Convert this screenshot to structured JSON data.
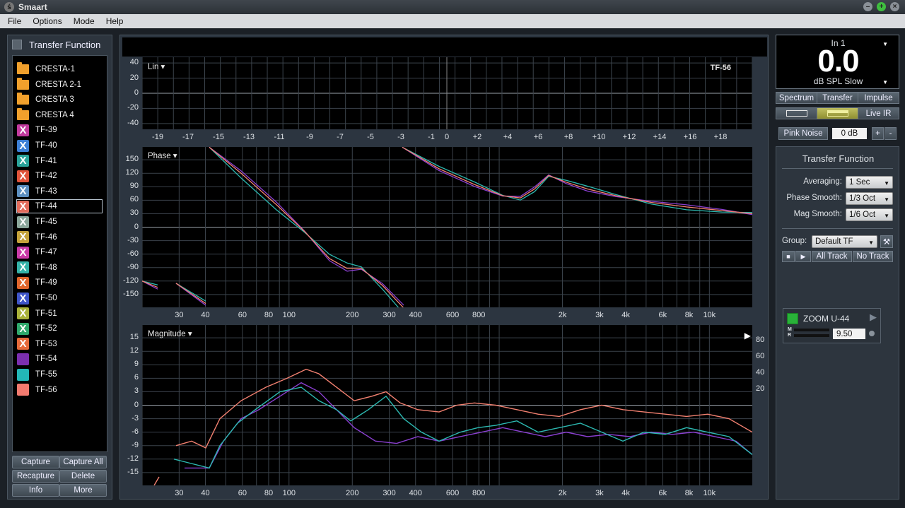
{
  "window": {
    "title": "Smaart"
  },
  "menu": [
    "File",
    "Options",
    "Mode",
    "Help"
  ],
  "sidebar": {
    "header": "Transfer Function",
    "items": [
      {
        "label": "CRESTA-1",
        "kind": "folder"
      },
      {
        "label": "CRESTA 2-1",
        "kind": "folder"
      },
      {
        "label": "CRESTA 3",
        "kind": "folder"
      },
      {
        "label": "CRESTA 4",
        "kind": "folder"
      },
      {
        "label": "TF-39",
        "kind": "x",
        "color": "#c23a9e"
      },
      {
        "label": "TF-40",
        "kind": "x",
        "color": "#3c7fd6"
      },
      {
        "label": "TF-41",
        "kind": "x",
        "color": "#2aa39a"
      },
      {
        "label": "TF-42",
        "kind": "x",
        "color": "#e0533a"
      },
      {
        "label": "TF-43",
        "kind": "x",
        "color": "#5c8fc0"
      },
      {
        "label": "TF-44",
        "kind": "x",
        "color": "#e26c5c",
        "selected": true
      },
      {
        "label": "TF-45",
        "kind": "x",
        "color": "#8aa69a"
      },
      {
        "label": "TF-46",
        "kind": "x",
        "color": "#c4a23a"
      },
      {
        "label": "TF-47",
        "kind": "x",
        "color": "#c93aa8"
      },
      {
        "label": "TF-48",
        "kind": "x",
        "color": "#34b2a8"
      },
      {
        "label": "TF-49",
        "kind": "x",
        "color": "#e0652c"
      },
      {
        "label": "TF-50",
        "kind": "x",
        "color": "#3f55c8"
      },
      {
        "label": "TF-51",
        "kind": "x",
        "color": "#a9b23a"
      },
      {
        "label": "TF-52",
        "kind": "x",
        "color": "#2fa86c"
      },
      {
        "label": "TF-53",
        "kind": "x",
        "color": "#e66a3a"
      },
      {
        "label": "TF-54",
        "kind": "solid",
        "color": "#7b2fb0"
      },
      {
        "label": "TF-55",
        "kind": "solid",
        "color": "#23b8b8"
      },
      {
        "label": "TF-56",
        "kind": "solid",
        "color": "#f27a6f"
      }
    ],
    "buttons": [
      "Capture",
      "Capture All",
      "Recapture",
      "Delete",
      "Info",
      "More"
    ]
  },
  "plots": {
    "live": {
      "label": "Lin",
      "trace": "TF-56",
      "y_ticks": [
        "40",
        "20",
        "0",
        "-20",
        "-40"
      ],
      "x_ticks": [
        "-19",
        "-17",
        "-15",
        "-13",
        "-11",
        "-9",
        "-7",
        "-5",
        "-3",
        "-1",
        "0",
        "+2",
        "+4",
        "+6",
        "+8",
        "+10",
        "+12",
        "+14",
        "+16",
        "+18"
      ]
    },
    "phase": {
      "label": "Phase",
      "y_ticks": [
        "150",
        "120",
        "90",
        "60",
        "30",
        "0",
        "-30",
        "-60",
        "-90",
        "-120",
        "-150"
      ],
      "x_ticks": [
        "30",
        "40",
        "60",
        "80",
        "100",
        "200",
        "300",
        "400",
        "600",
        "800",
        "2k",
        "3k",
        "4k",
        "6k",
        "8k",
        "10k"
      ]
    },
    "magnitude": {
      "label": "Magnitude",
      "y_ticks": [
        "15",
        "12",
        "9",
        "6",
        "3",
        "0",
        "-3",
        "-6",
        "-9",
        "-12",
        "-15"
      ],
      "y2_ticks": [
        "80",
        "60",
        "40",
        "20"
      ],
      "x_ticks": [
        "30",
        "40",
        "60",
        "80",
        "100",
        "200",
        "300",
        "400",
        "600",
        "800",
        "2k",
        "3k",
        "4k",
        "6k",
        "8k",
        "10k"
      ]
    }
  },
  "meter": {
    "channel": "In 1",
    "value": "0.0",
    "unit": "dB SPL Slow"
  },
  "modes": [
    "Spectrum",
    "Transfer",
    "Impulse"
  ],
  "live_ir": "Live IR",
  "generator": {
    "label": "Pink Noise",
    "level": "0 dB",
    "plus": "+",
    "minus": "-"
  },
  "tf_settings": {
    "title": "Transfer Function",
    "averaging_label": "Averaging:",
    "averaging": "1 Sec",
    "phase_smooth_label": "Phase Smooth:",
    "phase_smooth": "1/3 Oct",
    "mag_smooth_label": "Mag Smooth:",
    "mag_smooth": "1/6 Oct",
    "group_label": "Group:",
    "group": "Default TF",
    "all_track": "All Track",
    "no_track": "No Track"
  },
  "device": {
    "name": "ZOOM U-44",
    "m": "M",
    "r": "R",
    "delay": "9.50"
  },
  "colors": {
    "trace_salmon": "#f28070",
    "trace_teal": "#2cb8b0",
    "trace_purple": "#8a3fd0",
    "bg": "#1b2026"
  }
}
